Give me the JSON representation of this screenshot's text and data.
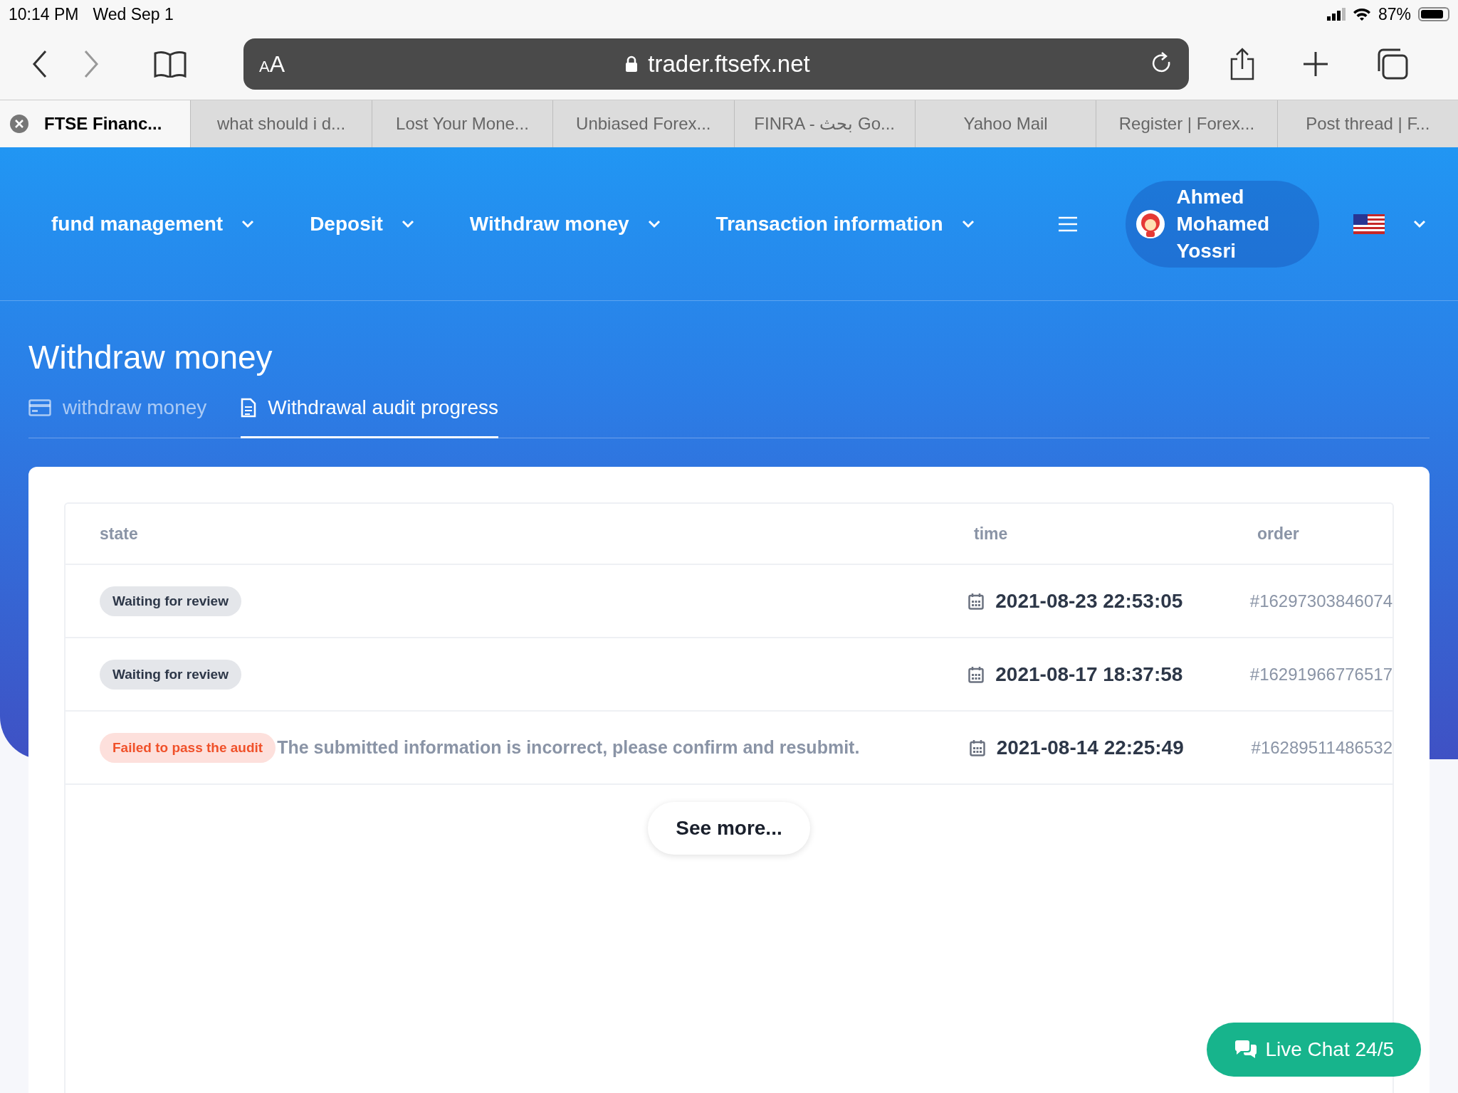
{
  "status_bar": {
    "time": "10:14 PM",
    "date": "Wed Sep 1",
    "battery": {
      "text": "87%",
      "level": 0.87
    }
  },
  "browser": {
    "text_size": "AA",
    "address": "trader.ftsefx.net",
    "tabs": [
      {
        "title": "FTSE Financ...",
        "selected": true
      },
      {
        "title": "what should i d...",
        "selected": false
      },
      {
        "title": "Lost Your Mone...",
        "selected": false
      },
      {
        "title": "Unbiased Forex...",
        "selected": false
      },
      {
        "title": "FINRA - بحث Go...",
        "selected": false
      },
      {
        "title": "Yahoo Mail",
        "selected": false
      },
      {
        "title": "Register | Forex...",
        "selected": false
      },
      {
        "title": "Post thread | F...",
        "selected": false
      }
    ]
  },
  "nav": {
    "items": [
      {
        "label": "fund management"
      },
      {
        "label": "Deposit"
      },
      {
        "label": "Withdraw money"
      },
      {
        "label": "Transaction information"
      }
    ],
    "user": {
      "name": "Ahmed Mohamed Yossri"
    }
  },
  "page_title": "Withdraw money",
  "subtabs": [
    {
      "label": "withdraw money",
      "kind": "card",
      "selected": false
    },
    {
      "label": "Withdrawal audit progress",
      "kind": "document",
      "selected": true
    }
  ],
  "table": {
    "columns": [
      "state",
      "time",
      "order"
    ],
    "rows": [
      {
        "status": "Waiting for review",
        "kind": "waiting",
        "time": "2021-08-23 22:53:05",
        "order": "#16297303846074"
      },
      {
        "status": "Waiting for review",
        "kind": "waiting",
        "time": "2021-08-17 18:37:58",
        "order": "#16291966776517"
      },
      {
        "status": "Failed to pass the audit",
        "kind": "failed",
        "message": "The submitted information is incorrect, please confirm and resubmit.",
        "time": "2021-08-14 22:25:49",
        "order": "#16289511486532"
      }
    ]
  },
  "see_more": "See more...",
  "live_chat": "Live Chat 24/5"
}
